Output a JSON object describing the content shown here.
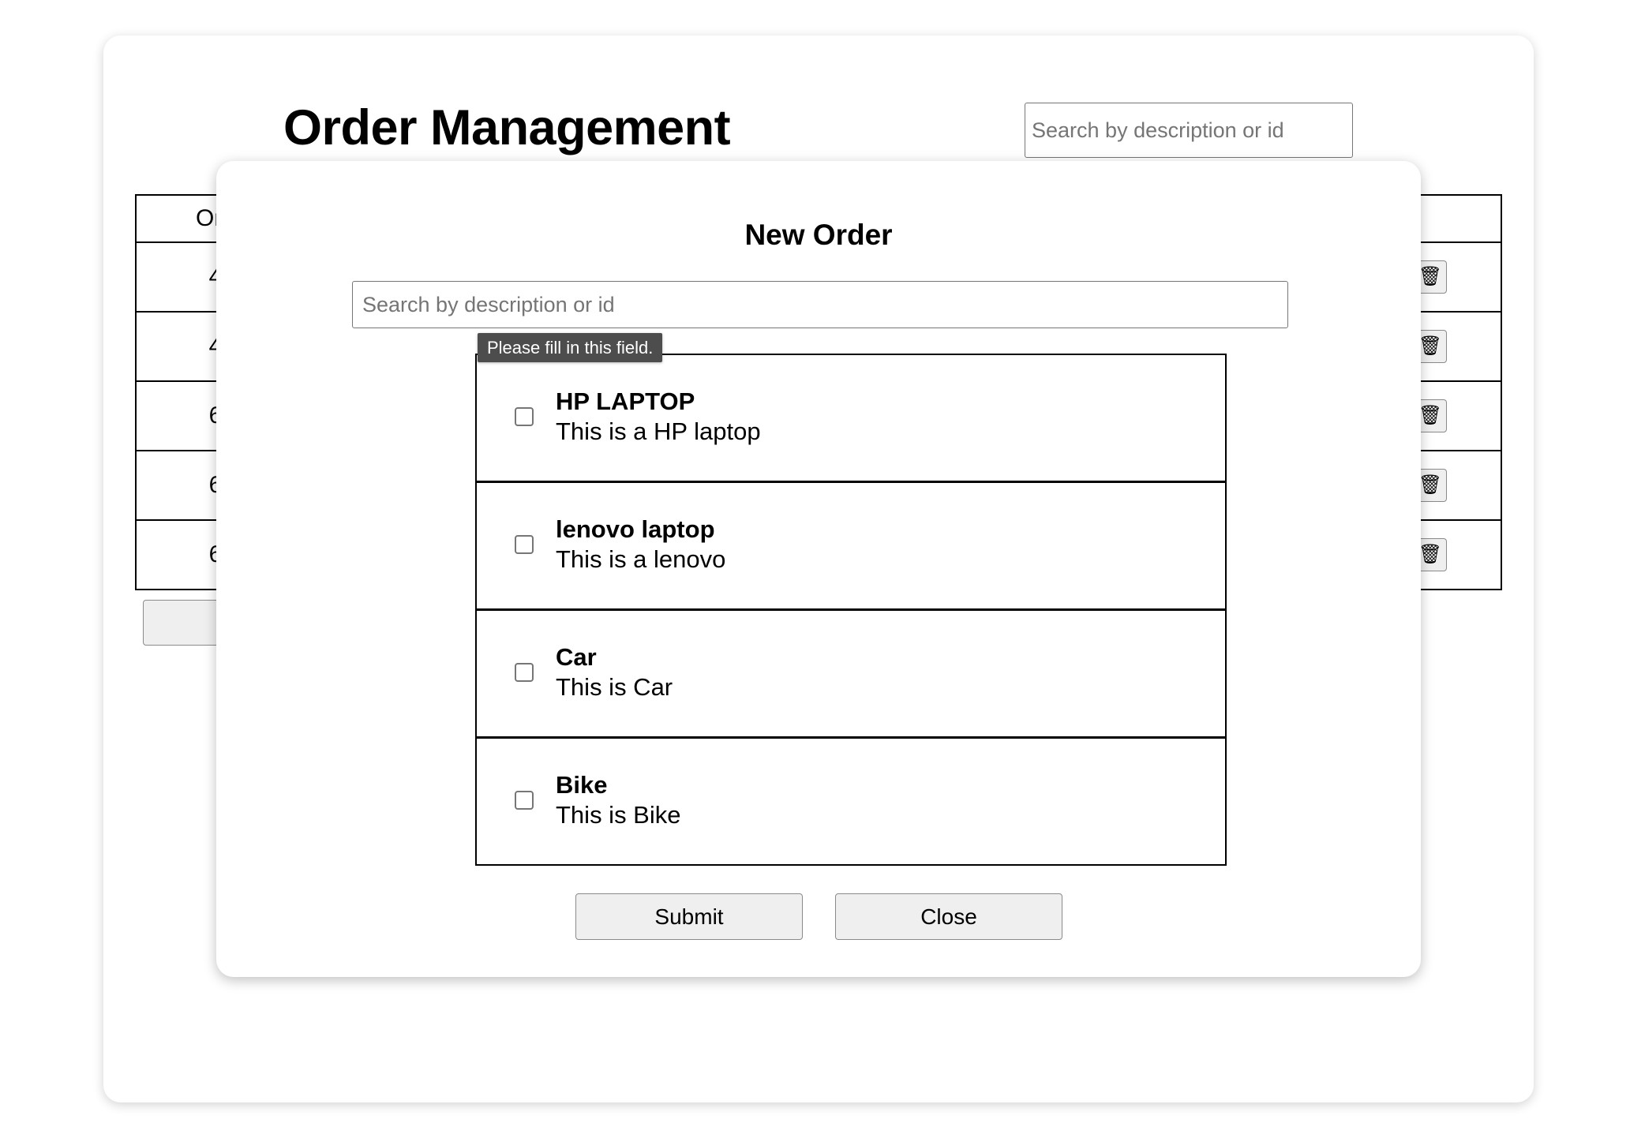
{
  "page": {
    "title": "Order Management",
    "search_placeholder": "Search by description or id"
  },
  "orders_table": {
    "header_first_visible": "Ord",
    "row_id_visible": [
      "4",
      "4",
      "6",
      "6",
      "6"
    ]
  },
  "new_order_button_visible": "N",
  "modal": {
    "title": "New Order",
    "search_placeholder": "Search by description or id",
    "validation_tooltip": "Please fill in this field.",
    "products": [
      {
        "name": "HP LAPTOP",
        "description": "This is a HP laptop",
        "checked": false
      },
      {
        "name": "lenovo laptop",
        "description": "This is a lenovo",
        "checked": false
      },
      {
        "name": "Car",
        "description": "This is Car",
        "checked": false
      },
      {
        "name": "Bike",
        "description": "This is Bike",
        "checked": false
      }
    ],
    "submit_label": "Submit",
    "close_label": "Close"
  },
  "icons": {
    "delete": "trash-icon"
  }
}
